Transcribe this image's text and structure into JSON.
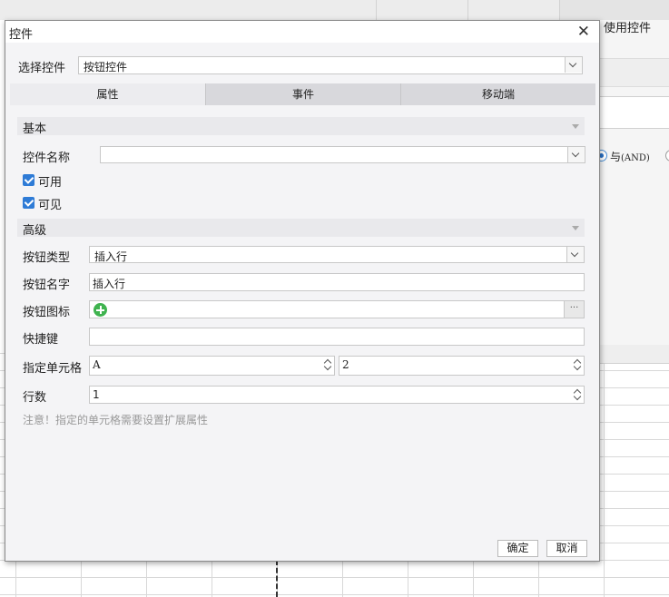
{
  "background": {
    "right_panel_label": "使用控件",
    "radio_label": "与",
    "radio_label_suffix": "(AND)"
  },
  "dialog": {
    "title": "控件",
    "select_widget": {
      "label": "选择控件",
      "value": "按钮控件"
    },
    "tabs": [
      {
        "label": "属性",
        "active": true
      },
      {
        "label": "事件",
        "active": false
      },
      {
        "label": "移动端",
        "active": false
      }
    ],
    "basic": {
      "section_label": "基本",
      "name_label": "控件名称",
      "name_value": "",
      "enabled": {
        "label": "可用",
        "checked": true
      },
      "visible": {
        "label": "可见",
        "checked": true
      }
    },
    "advanced": {
      "section_label": "高级",
      "button_type": {
        "label": "按钮类型",
        "value": "插入行"
      },
      "button_name": {
        "label": "按钮名字",
        "value": "插入行"
      },
      "button_icon": {
        "label": "按钮图标",
        "icon": "plus-circle-icon",
        "more": "···"
      },
      "shortcut": {
        "label": "快捷键",
        "value": ""
      },
      "cell": {
        "label": "指定单元格",
        "column": "A",
        "row": "2"
      },
      "rows": {
        "label": "行数",
        "value": "1"
      },
      "note": "注意！指定的单元格需要设置扩展属性"
    },
    "buttons": {
      "ok": "确定",
      "cancel": "取消"
    }
  },
  "colors": {
    "accent": "#2e7bd6",
    "icon_green": "#3fb34f"
  }
}
